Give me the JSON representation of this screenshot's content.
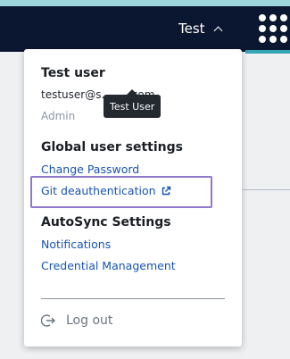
{
  "header": {
    "user_label": "Test",
    "apps_icon": "apps-grid-icon",
    "chevron_icon": "chevron-up-icon"
  },
  "dropdown": {
    "user_name": "Test user",
    "email": "testuser@s.........com",
    "role": "Admin",
    "global_settings": {
      "title": "Global user settings",
      "links": [
        "Change Password",
        "Git deauthentication"
      ]
    },
    "autosync": {
      "title": "AutoSync Settings",
      "links": [
        "Notifications",
        "Credential Management"
      ]
    },
    "logout_label": "Log out"
  },
  "tooltip": "Test User",
  "colors": {
    "header_bg": "#0b1730",
    "link": "#1753b4",
    "highlight": "#8f77c9"
  }
}
